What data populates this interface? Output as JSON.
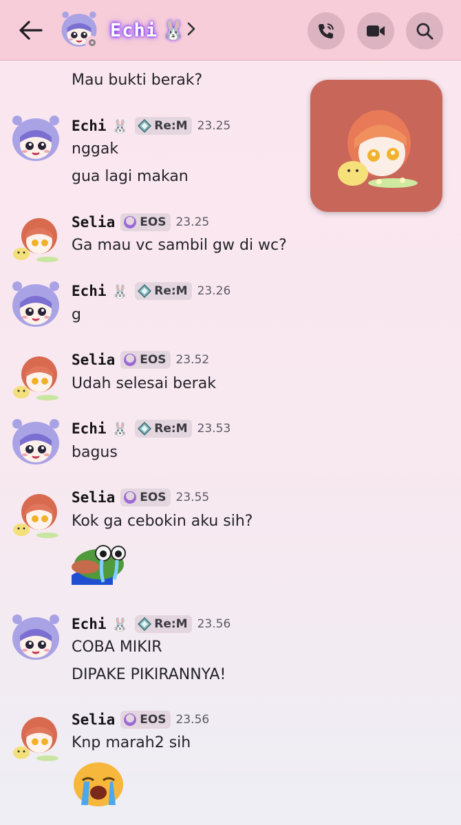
{
  "header": {
    "title": "Echi",
    "title_emoji": "🐰",
    "icons": [
      "back-arrow-icon",
      "chevron-right-icon",
      "voice-call-icon",
      "video-call-icon",
      "search-icon"
    ]
  },
  "top_partial_message": "Mau bukti berak?",
  "users": {
    "echi": {
      "name": "Echi",
      "emoji": "🐰",
      "tag": "Re:M"
    },
    "selia": {
      "name": "Selia",
      "tag": "EOS"
    }
  },
  "messages": [
    {
      "author": "Echi",
      "emoji": "🐰",
      "tag": "Re:M",
      "time": "23.25",
      "lines": [
        "nggak",
        "gua lagi makan"
      ]
    },
    {
      "author": "Selia",
      "tag": "EOS",
      "time": "23.25",
      "lines": [
        "Ga mau vc sambil gw di wc?"
      ]
    },
    {
      "author": "Echi",
      "emoji": "🐰",
      "tag": "Re:M",
      "time": "23.26",
      "lines": [
        "g"
      ]
    },
    {
      "author": "Selia",
      "tag": "EOS",
      "time": "23.52",
      "lines": [
        "Udah selesai berak"
      ]
    },
    {
      "author": "Echi",
      "emoji": "🐰",
      "tag": "Re:M",
      "time": "23.53",
      "lines": [
        "bagus"
      ]
    },
    {
      "author": "Selia",
      "tag": "EOS",
      "time": "23.55",
      "lines": [
        "Kok ga cebokin aku sih?"
      ],
      "sticker": "crying-frog-sticker"
    },
    {
      "author": "Echi",
      "emoji": "🐰",
      "tag": "Re:M",
      "time": "23.56",
      "lines": [
        "COBA MIKIR",
        "DIPAKE PIKIRANNYA!"
      ]
    },
    {
      "author": "Selia",
      "tag": "EOS",
      "time": "23.56",
      "lines": [
        "Knp marah2 sih"
      ],
      "sticker": "sobbing-face-sticker"
    }
  ],
  "colors": {
    "header_bg": "#f6cdd9",
    "accent_purple": "#7a2cff",
    "pip_bg": "#c8665a",
    "tag_bg": "#e4d6de"
  }
}
